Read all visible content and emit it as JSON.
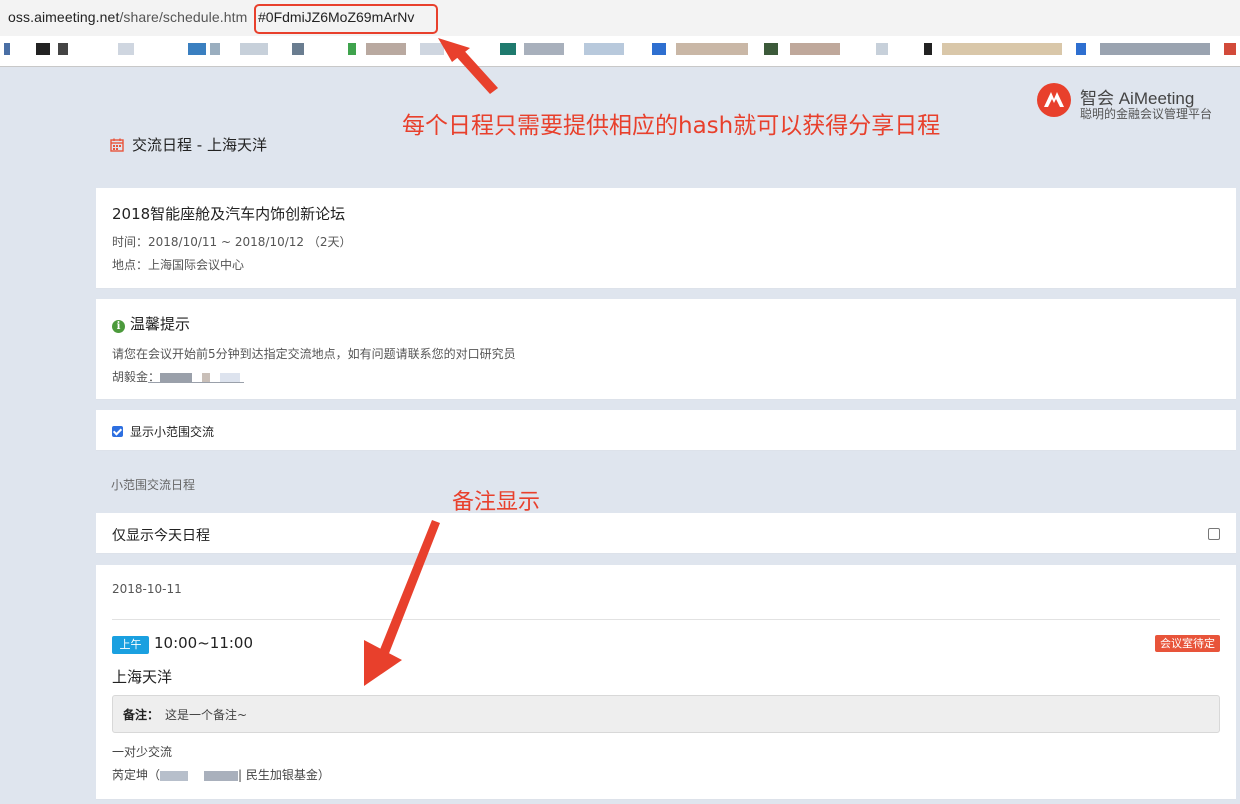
{
  "browser": {
    "url_host": "oss.aimeeting.net",
    "url_path": "/share/schedule.htm",
    "url_hash": "#0FdmiJZ6MoZ69mArNv"
  },
  "brand": {
    "logo_icon": "aimeeting-logo-icon",
    "name": "智会 AiMeeting",
    "tagline": "聪明的金融会议管理平台",
    "accent_color": "#e8402c"
  },
  "annotations": {
    "hash_note": "每个日程只需要提供相应的hash就可以获得分享日程",
    "remark_note": "备注显示",
    "color": "#e8402c"
  },
  "page": {
    "title": "交流日程 - 上海天洋",
    "title_icon": "calendar-icon"
  },
  "event": {
    "name": "2018智能座舱及汽车内饰创新论坛",
    "time_label": "时间：",
    "time_value": "2018/10/11 ~ 2018/10/12 （2天）",
    "place_label": "地点：",
    "place_value": "上海国际会议中心"
  },
  "tip": {
    "icon": "info-icon",
    "title": "温馨提示",
    "text": "请您在会议开始前5分钟到达指定交流地点，如有问题请联系您的对口研究员",
    "contact_label": "胡毅金："
  },
  "filter": {
    "show_small_label": "显示小范围交流",
    "show_small_checked": true
  },
  "section": {
    "label": "小范围交流日程",
    "today_only_label": "仅显示今天日程",
    "today_only_checked": false
  },
  "schedule": {
    "date": "2018-10-11",
    "period_badge": "上午",
    "period_color": "#1aa0e0",
    "time": "10:00~11:00",
    "status_badge": "会议室待定",
    "status_color": "#e8543a",
    "venue": "上海天洋",
    "note_label": "备注：",
    "note_text": "这是一个备注~",
    "type": "一对少交流",
    "attendee_name": "芮定坤（",
    "attendee_org": "| 民生加银基金）"
  }
}
